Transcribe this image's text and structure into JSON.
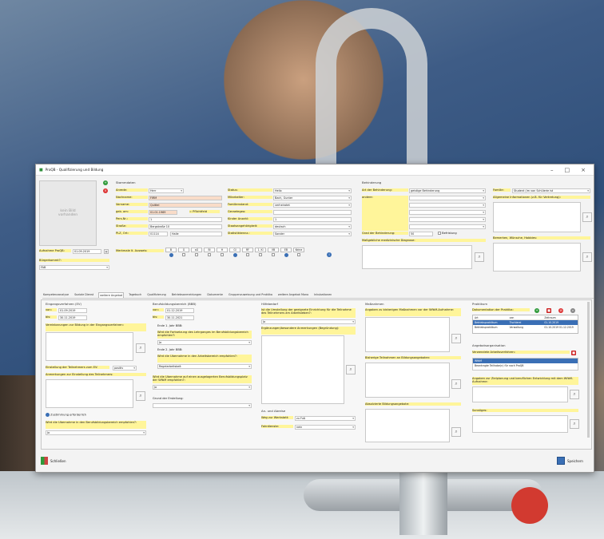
{
  "window": {
    "title": "ProQB - Qualifizierung und Bildung"
  },
  "photo": {
    "placeholder": "kein Bild vorhanden"
  },
  "left": {
    "aufnahme_label": "Aufnahme ProQB:",
    "aufnahme_value": "01.09.2019",
    "buergerkommt_label": "Bürgerkommt?:",
    "buergerkommt_value": "FAB"
  },
  "stamm": {
    "title": "Stammdaten",
    "fields": [
      {
        "label": "Anrede:",
        "value": "Herr"
      },
      {
        "label": "Nachname:",
        "value": "FIRM"
      },
      {
        "label": "Vorname:",
        "value": "Quittel"
      },
      {
        "label": "geb. am:",
        "value": "01.01.1969",
        "extra": "= Pflichtfeld"
      },
      {
        "label": "Pers.Nr.:",
        "value": "1"
      },
      {
        "label": "Straße:",
        "value": "Bergstraße 10"
      },
      {
        "label": "PLZ, Ort:",
        "value": "01114",
        "extra": "Halle"
      }
    ],
    "merkmale_label": "Merkmale lt. Ausweis:",
    "merkmale": [
      "B",
      "G",
      "aG",
      "Bl",
      "H",
      "Gl",
      "RF",
      "1. Kl",
      "VB",
      "EB",
      "Keine"
    ]
  },
  "mid": {
    "fields": [
      {
        "label": "Status:",
        "value": "Hello"
      },
      {
        "label": "Mitarbeiter:",
        "value": "Bach, Gunter"
      },
      {
        "label": "Familienstand:",
        "value": "verheiratet"
      },
      {
        "label": "Geraetegeo:",
        "value": ""
      },
      {
        "label": "Kinder Anzahl:",
        "value": "1"
      },
      {
        "label": "Staatsangehörigkeit:",
        "value": "deutsch"
      },
      {
        "label": "Statistikkennz.:",
        "value": "Sonder"
      }
    ]
  },
  "behinderung": {
    "title": "Behinderung",
    "fields": [
      {
        "label": "Art der Behinderung:",
        "value": "geistige Behinderung"
      },
      {
        "label": "andere:",
        "value": ""
      },
      {
        "label": "Grad der Behinderung:",
        "value": "50"
      }
    ],
    "befristung": "Befristung",
    "diagnose_label": "Maßgebliche medizinische Diagnose:"
  },
  "right": {
    "familie_label": "Familie:",
    "familie_value": "Student (im von Schülerie ist",
    "allg_label": "Allgemeine Informationen (z.B. für Vertretung):",
    "bemerk_label": "Bemerken, Wünsche, Hobbies:"
  },
  "tabs": [
    "Kompetenzanalyse",
    "Soziale Dienst",
    "weitere Angebot",
    "Tagebuch",
    "Qualifizierung",
    "Betriebsanmeldungen",
    "Dokumente",
    "Gruppenzuweisung und Praktika",
    "weitere Angebot Mono",
    "Inkubationen"
  ],
  "tab_active": 2,
  "eingang": {
    "title": "Eingangsverfahren (EV)",
    "von_label": "von:",
    "von": "01.09.2019",
    "bis_label": "bis:",
    "bis": "30.11.2019",
    "ziele_label": "Vereinbarungen zur Bildung in der Eingangsverfahren:",
    "einstellung_label": "Einstellung der Teilnehmers zum EV:",
    "einstellung_value": "positiv",
    "anmerkung_label": "Anmerkungen zur Einstellung des Teilnehmers:",
    "zustimmung": "Zustimmung erforderlich",
    "uebernahme_label": "Wird die Übernahme in den Berufsbildungsbereich empfohlen?:",
    "uebernahme_value": "Ja"
  },
  "bbb": {
    "title": "Berufsbildungsbereich (BBB)",
    "von_label": "von:",
    "von": "01.12.2019",
    "bis_label": "bis:",
    "bis": "30.11.2021",
    "jahr1": "Ende 1. Jahr BBB:",
    "q1": "Wird die Fortsetzung des Lehrganges im Berufsbildungsbereich empfohlen?:",
    "a1": "Ja",
    "jahr2": "Ende 2. Jahr BBB:",
    "q2": "Wird die Übernahme in den Arbeitsbereich empfohlen?:",
    "a2": "Regelarbeitsbeit",
    "q3": "Wird die Übernahme auf einen ausgelagerten Berufsbildungsplatz der WfbM empfohlen?:",
    "a3": "Ja",
    "grund_label": "Grund der Erstellung:"
  },
  "hilfe": {
    "title": "Hilfebedarf",
    "q": "Ist die Umstellung der geeignete Einrichtung für die Teilnahme des Teilnehmers am Arbeitsleben?:",
    "a": "Ja",
    "erg_label": "Ergänzungen/besondere Anmerkungen (Begründung):",
    "ar_title": "An- und Abreise",
    "weg_label": "Weg zur Werkstatt:",
    "weg_value": "zu Fuß",
    "fahr_label": "Fahrdienste:",
    "fahr_value": "nein"
  },
  "massnahmen": {
    "title": "Maßnahmen",
    "a_label": "Angaben zu bisherigen Maßnahmen vor der WfbM-Aufnahme:",
    "b_label": "Bisherige Teilnahmen an Bildungsangeboten:",
    "c_label": "Absolvierte Bildungsangebote:"
  },
  "praktikum": {
    "title": "Praktikum",
    "dok_label": "Dokumentation der Praktika:",
    "headers": [
      "Art",
      "von",
      "Zeitraum"
    ],
    "rows": [
      [
        "Art",
        "von",
        "Zeitraum"
      ],
      [
        "Betriebspraktikum",
        "Tischlerei",
        "01.10.2019"
      ],
      [
        "Betriebspraktikum",
        "Verwaltung",
        "01.10.2019 01.12.2019"
      ]
    ],
    "ang_title": "Angebotsorganisation",
    "verw_label": "Verwendete Arbeitsverfahren:",
    "items": [
      "WfbM",
      "Beantragte Teilhabe(n) für nach ProQB"
    ],
    "zielvereinb_label": "Angaben zur Zielplanung und beruflichen Entwicklung mit dem WfbM-Aufnahme:",
    "sonstiges_label": "Sonstiges:"
  },
  "footer": {
    "close": "Schließen",
    "save": "Speichern"
  }
}
